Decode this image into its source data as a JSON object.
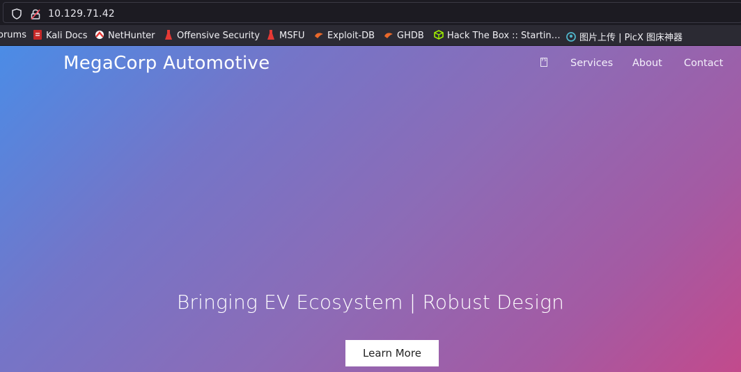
{
  "browser": {
    "url": "10.129.71.42",
    "bookmarks": [
      {
        "label": "orums",
        "icon": "forum-icon"
      },
      {
        "label": "Kali Docs",
        "icon": "kali-docs-icon",
        "color": "#d32f2f"
      },
      {
        "label": "NetHunter",
        "icon": "nethunter-icon",
        "color": "#e53935"
      },
      {
        "label": "Offensive Security",
        "icon": "offsec-icon",
        "color": "#e53935"
      },
      {
        "label": "MSFU",
        "icon": "msfu-icon",
        "color": "#e53935"
      },
      {
        "label": "Exploit-DB",
        "icon": "exploit-db-icon",
        "color": "#e8682a"
      },
      {
        "label": "GHDB",
        "icon": "ghdb-icon",
        "color": "#e8682a"
      },
      {
        "label": "Hack The Box :: Startin…",
        "icon": "htb-icon",
        "color": "#9fef00"
      },
      {
        "label": "图片上传 | PicX 图床神器",
        "icon": "picx-icon",
        "color": "#4fb3c8"
      }
    ]
  },
  "site": {
    "brand": "MegaCorp Automotive",
    "nav": {
      "icon_text": "FS",
      "links": [
        "Services",
        "About",
        "Contact"
      ]
    },
    "hero": {
      "title": "Bringing EV Ecosystem | Robust Design",
      "button": "Learn More"
    }
  }
}
